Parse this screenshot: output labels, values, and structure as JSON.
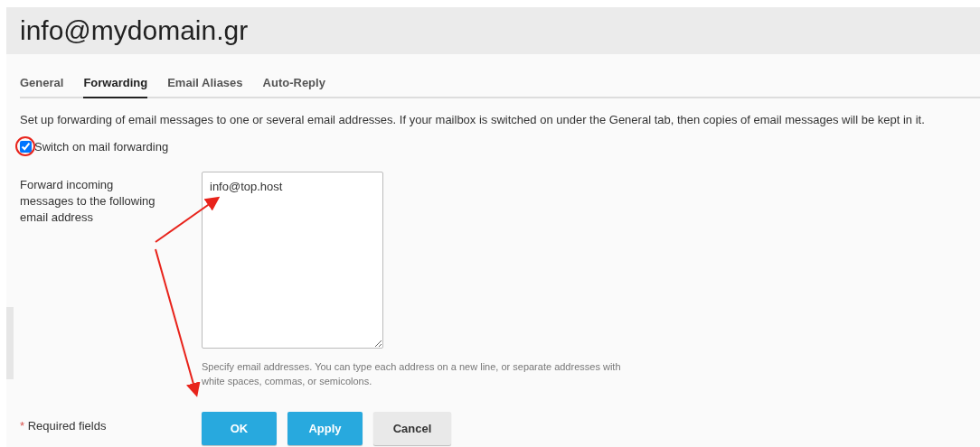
{
  "title": "info@mydomain.gr",
  "tabs": [
    {
      "label": "General",
      "selected": false
    },
    {
      "label": "Forwarding",
      "selected": true
    },
    {
      "label": "Email Aliases",
      "selected": false
    },
    {
      "label": "Auto-Reply",
      "selected": false
    }
  ],
  "description": "Set up forwarding of email messages to one or several email addresses. If your mailbox is switched on under the General tab, then copies of email messages will be kept in it.",
  "forwarding_switch": {
    "label": "Switch on mail forwarding",
    "checked": true
  },
  "forward_field": {
    "label": "Forward incoming messages to the following email address",
    "value": "info@top.host",
    "hint": "Specify email addresses. You can type each address on a new line, or separate addresses with white spaces, commas, or semicolons."
  },
  "required_note": {
    "mark": "*",
    "text": "Required fields"
  },
  "buttons": [
    {
      "label": "OK",
      "kind": "primary"
    },
    {
      "label": "Apply",
      "kind": "primary"
    },
    {
      "label": "Cancel",
      "kind": "secondary"
    }
  ]
}
